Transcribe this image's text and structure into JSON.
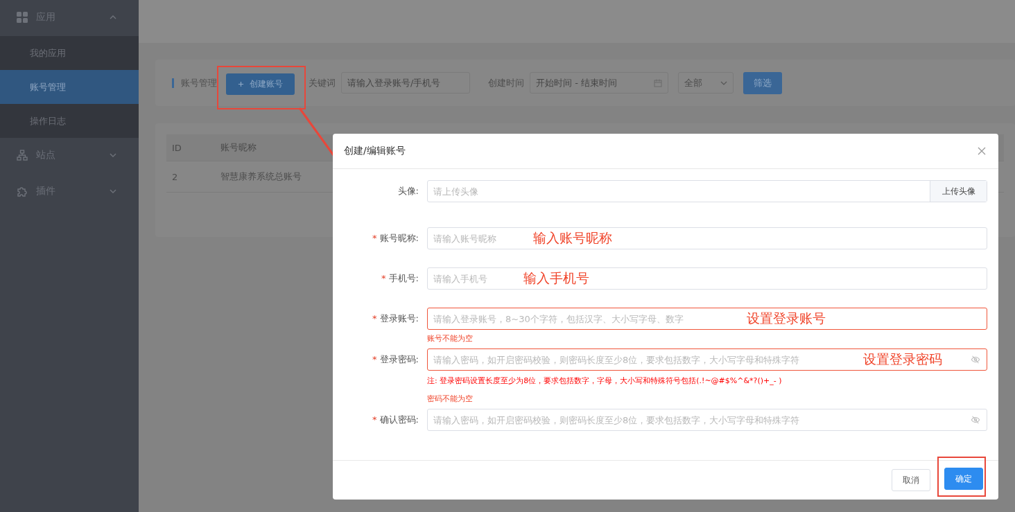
{
  "sidebar": {
    "groups": [
      {
        "label": "应用",
        "expanded": true,
        "children": [
          {
            "label": "我的应用",
            "selected": false
          },
          {
            "label": "账号管理",
            "selected": true
          },
          {
            "label": "操作日志",
            "selected": false
          }
        ]
      },
      {
        "label": "站点",
        "expanded": false
      },
      {
        "label": "插件",
        "expanded": false
      }
    ]
  },
  "toolbar": {
    "title": "账号管理",
    "create_button": {
      "label": "创建账号",
      "highlighted": true
    },
    "keyword_label": "关键词",
    "keyword_placeholder": "请输入登录账号/手机号",
    "time_label": "创建时间",
    "time_placeholder": "开始时间 - 结束时间",
    "status_select": "全部",
    "filter_button": "筛选"
  },
  "table": {
    "columns": [
      "ID",
      "账号昵称"
    ],
    "rows": [
      [
        "2",
        "智慧康养系统总账号"
      ]
    ]
  },
  "dialog": {
    "title": "创建/编辑账号",
    "fields": [
      {
        "kind": "upload",
        "label": "头像:",
        "placeholder": "请上传头像",
        "button": "上传头像",
        "invalid": false
      },
      {
        "kind": "text",
        "label": "账号昵称:",
        "required_mark": "*",
        "placeholder": "请输入账号昵称",
        "annotation": "输入账号昵称",
        "invalid": false
      },
      {
        "kind": "text",
        "label": "手机号:",
        "required_mark": "*",
        "placeholder": "请输入手机号",
        "annotation": "输入手机号",
        "invalid": false
      },
      {
        "kind": "text",
        "label": "登录账号:",
        "required_mark": "*",
        "placeholder": "请输入登录账号，8~30个字符，包括汉字、大小写字母、数字",
        "annotation": "设置登录账号",
        "invalid": true,
        "error": "账号不能为空"
      },
      {
        "kind": "password",
        "label": "登录密码:",
        "required_mark": "*",
        "placeholder": "请输入密码，如开启密码校验，则密码长度至少8位，要求包括数字，大小写字母和特殊字符",
        "annotation": "设置登录密码",
        "invalid": true,
        "note": "注: 登录密码设置长度至少为8位，要求包括数字，字母，大小写和特殊符号包括(.!~@#$%^&*?()+_- )",
        "error": "密码不能为空"
      },
      {
        "kind": "password",
        "label": "确认密码:",
        "required_mark": "*",
        "placeholder": "请输入密码，如开启密码校验，则密码长度至少8位，要求包括数字，大小写字母和特殊字符",
        "invalid": false
      }
    ],
    "buttons": [
      {
        "kind": "secondary",
        "label": "取消",
        "highlighted": false
      },
      {
        "kind": "primary",
        "label": "确定",
        "highlighted": true
      }
    ]
  }
}
